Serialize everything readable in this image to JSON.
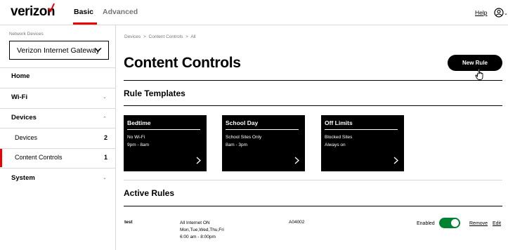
{
  "header": {
    "logo": "verizon",
    "tabs": [
      {
        "label": "Basic",
        "active": true
      },
      {
        "label": "Advanced",
        "active": false
      }
    ],
    "help_label": "Help",
    "accent_color": "#ee0000"
  },
  "sidebar": {
    "network_devices_label": "Network Devices",
    "selected_device": "Verizon Internet Gateway",
    "items": [
      {
        "label": "Home"
      },
      {
        "label": "Wi-Fi"
      },
      {
        "label": "Devices",
        "expanded": true
      },
      {
        "label": "System"
      }
    ],
    "sub_items": [
      {
        "label": "Devices",
        "count": "2"
      },
      {
        "label": "Content Controls",
        "count": "1",
        "active": true
      }
    ]
  },
  "main": {
    "breadcrumb": [
      "Devices",
      ">",
      "Content Controls",
      ">",
      "All"
    ],
    "title": "Content Controls",
    "new_rule_label": "New Rule",
    "rule_templates_title": "Rule Templates",
    "templates": [
      {
        "title": "Bedtime",
        "line1": "No Wi-Fi",
        "line2": "9pm - 8am"
      },
      {
        "title": "School Day",
        "line1": "School Sites Only",
        "line2": "8am - 3pm"
      },
      {
        "title": "Off Limits",
        "line1": "Blocked Sites",
        "line2": "Always on"
      }
    ],
    "active_rules_title": "Active Rules",
    "active_rules": [
      {
        "name": "test",
        "detail1": "All Internet ON",
        "detail2": "Mon,Tue,Wed,Thu,Fri",
        "detail3": "6:00 am - 8:00pm",
        "code": "A04002",
        "status": "Enabled",
        "enabled": true,
        "remove_label": "Remove",
        "edit_label": "Edit"
      }
    ],
    "toggle_color": "#008331"
  }
}
